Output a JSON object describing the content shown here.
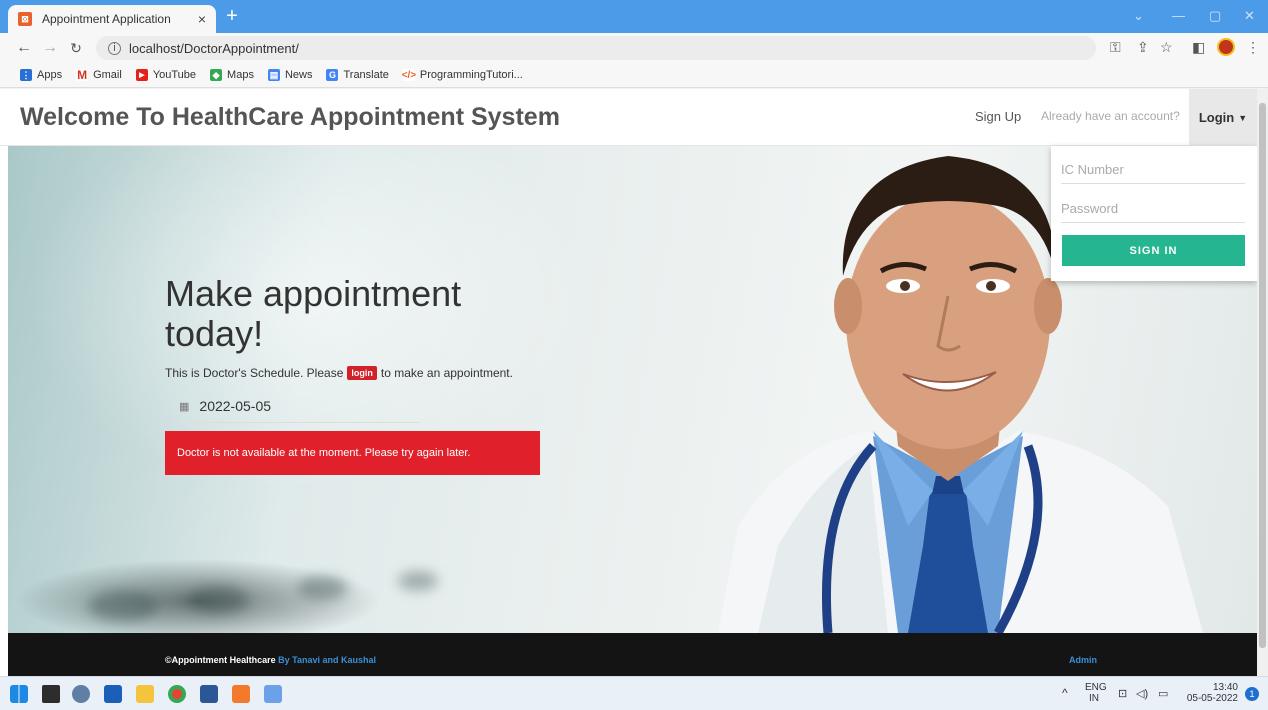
{
  "browser": {
    "tab_title": "Appointment Application",
    "tab_close": "×",
    "new_tab": "+",
    "url": "localhost/DoctorAppointment/",
    "bookmarks": [
      "Apps",
      "Gmail",
      "YouTube",
      "Maps",
      "News",
      "Translate",
      "ProgrammingTutori..."
    ]
  },
  "navbar": {
    "brand": "Welcome To HealthCare Appointment System",
    "signup": "Sign Up",
    "already": "Already have an account?",
    "login": "Login"
  },
  "hero": {
    "title": "Make appointment today!",
    "sub_before": "This is Doctor's Schedule. Please",
    "login_badge": "login",
    "sub_after": "to make an appointment.",
    "date": "2022-05-05",
    "alert": "Doctor is not available at the moment. Please try again later."
  },
  "login_dropdown": {
    "ic_placeholder": "IC Number",
    "password_placeholder": "Password",
    "signin": "SIGN IN"
  },
  "footer": {
    "left": "©Appointment Healthcare",
    "by": "By Tanavi and Kaushal",
    "admin": "Admin"
  },
  "taskbar": {
    "lang_top": "ENG",
    "lang_bottom": "IN",
    "time": "13:40",
    "date": "05-05-2022",
    "notifications": "1"
  },
  "colors": {
    "accent_signin": "#25b591",
    "alert_red": "#e0202a",
    "footer_link": "#3b8fd9",
    "chrome_blue": "#4c9be8"
  }
}
